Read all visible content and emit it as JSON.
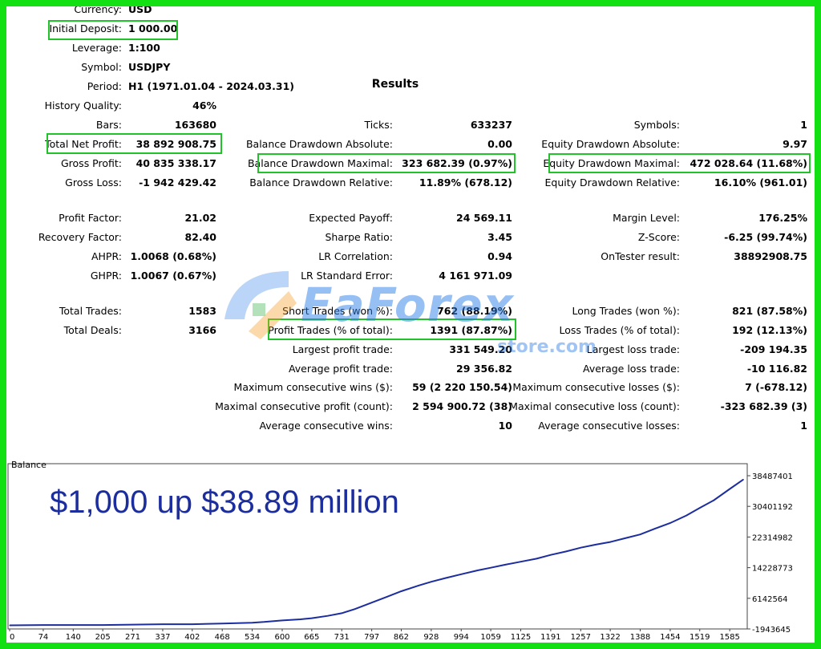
{
  "left": [
    {
      "label": "Currency:",
      "value": "USD"
    },
    {
      "label": "Initial Deposit:",
      "value": "1 000.00"
    },
    {
      "label": "Leverage:",
      "value": "1:100"
    },
    {
      "label": "Symbol:",
      "value": "USDJPY"
    },
    {
      "label": "Period:",
      "value": "H1 (1971.01.04 - 2024.03.31)"
    },
    {
      "label": "History Quality:",
      "value": "46%"
    },
    {
      "label": "Bars:",
      "value": "163680"
    },
    {
      "label": "Total Net Profit:",
      "value": "38 892 908.75"
    },
    {
      "label": "Gross Profit:",
      "value": "40 835 338.17"
    },
    {
      "label": "Gross Loss:",
      "value": "-1 942 429.42"
    },
    {
      "label": "Profit Factor:",
      "value": "21.02"
    },
    {
      "label": "Recovery Factor:",
      "value": "82.40"
    },
    {
      "label": "AHPR:",
      "value": "1.0068 (0.68%)"
    },
    {
      "label": "GHPR:",
      "value": "1.0067 (0.67%)"
    },
    {
      "label": "Total Trades:",
      "value": "1583"
    },
    {
      "label": "Total Deals:",
      "value": "3166"
    }
  ],
  "results_title": "Results",
  "middle": [
    {
      "label": "Ticks:",
      "value": "633237"
    },
    {
      "label": "Balance Drawdown Absolute:",
      "value": "0.00"
    },
    {
      "label": "Balance Drawdown Maximal:",
      "value": "323 682.39 (0.97%)"
    },
    {
      "label": "Balance Drawdown Relative:",
      "value": "11.89% (678.12)"
    },
    {
      "label": "Expected Payoff:",
      "value": "24 569.11"
    },
    {
      "label": "Sharpe Ratio:",
      "value": "3.45"
    },
    {
      "label": "LR Correlation:",
      "value": "0.94"
    },
    {
      "label": "LR Standard Error:",
      "value": "4 161 971.09"
    },
    {
      "label": "Short Trades (won %):",
      "value": "762 (88.19%)"
    },
    {
      "label": "Profit Trades (% of total):",
      "value": "1391 (87.87%)"
    },
    {
      "label": "Largest profit trade:",
      "value": "331 549.20"
    },
    {
      "label": "Average profit trade:",
      "value": "29 356.82"
    },
    {
      "label": "Maximum consecutive wins ($):",
      "value": "59 (2 220 150.54)"
    },
    {
      "label": "Maximal consecutive profit (count):",
      "value": "2 594 900.72 (38)"
    },
    {
      "label": "Average consecutive wins:",
      "value": "10"
    }
  ],
  "right": [
    {
      "label": "Symbols:",
      "value": "1"
    },
    {
      "label": "Equity Drawdown Absolute:",
      "value": "9.97"
    },
    {
      "label": "Equity Drawdown Maximal:",
      "value": "472 028.64 (11.68%)"
    },
    {
      "label": "Equity Drawdown Relative:",
      "value": "16.10% (961.01)"
    },
    {
      "label": "Margin Level:",
      "value": "176.25%"
    },
    {
      "label": "Z-Score:",
      "value": "-6.25 (99.74%)"
    },
    {
      "label": "OnTester result:",
      "value": "38892908.75"
    },
    {
      "label": "Long Trades (won %):",
      "value": "821 (87.58%)"
    },
    {
      "label": "Loss Trades (% of total):",
      "value": "192 (12.13%)"
    },
    {
      "label": "Largest loss trade:",
      "value": "-209 194.35"
    },
    {
      "label": "Average loss trade:",
      "value": "-10 116.82"
    },
    {
      "label": "Maximum consecutive losses ($):",
      "value": "7 (-678.12)"
    },
    {
      "label": "Maximal consecutive loss (count):",
      "value": "-323 682.39 (3)"
    },
    {
      "label": "Average consecutive losses:",
      "value": "1"
    }
  ],
  "watermark": {
    "text": "EaForex",
    "sub": "store.com"
  },
  "headline": "$1,000 up $38.89 million",
  "colors": {
    "frame": "#12e012",
    "highlight": "#22c22a",
    "line": "#1c2d9e",
    "headline": "#1c2d9e",
    "watermark": "#2f80e8"
  },
  "chart_data": {
    "type": "line",
    "title": "Balance",
    "y_ticks": [
      "38487401",
      "30401192",
      "22314982",
      "14228773",
      "6142564",
      "-1943645"
    ],
    "x_ticks": [
      "0",
      "74",
      "140",
      "205",
      "271",
      "337",
      "402",
      "468",
      "534",
      "600",
      "665",
      "731",
      "797",
      "862",
      "928",
      "994",
      "1059",
      "1125",
      "1191",
      "1257",
      "1322",
      "1388",
      "1454",
      "1519",
      "1585"
    ],
    "ylim": [
      -1943645,
      38487401
    ],
    "series": [
      {
        "values_x": [
          0,
          74,
          140,
          205,
          271,
          337,
          402,
          468,
          534,
          560,
          600,
          640,
          665,
          700,
          731,
          760,
          797,
          830,
          862,
          900,
          928,
          960,
          994,
          1030,
          1059,
          1090,
          1125,
          1160,
          1191,
          1225,
          1257,
          1290,
          1322,
          1355,
          1388,
          1420,
          1454,
          1490,
          1519,
          1550,
          1585,
          1615
        ],
        "values_y": [
          -1000000,
          -900000,
          -900000,
          -900000,
          -800000,
          -700000,
          -700000,
          -500000,
          -300000,
          -100000,
          300000,
          600000,
          900000,
          1500000,
          2200000,
          3300000,
          5000000,
          6500000,
          8000000,
          9500000,
          10500000,
          11500000,
          12500000,
          13500000,
          14200000,
          15000000,
          15800000,
          16600000,
          17600000,
          18500000,
          19500000,
          20300000,
          21000000,
          22000000,
          23000000,
          24500000,
          26000000,
          28000000,
          30000000,
          32000000,
          35000000,
          37500000
        ]
      }
    ]
  }
}
